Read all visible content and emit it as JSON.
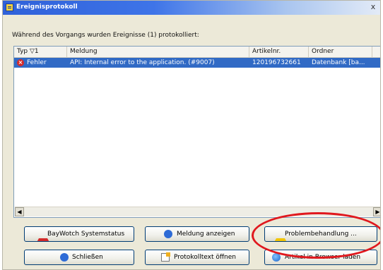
{
  "window": {
    "title": "Ereignisprotokoll",
    "close_glyph": "x"
  },
  "info_text": "Während des Vorgangs wurden Ereignisse (1) protokolliert:",
  "table": {
    "columns": [
      "Typ ▽1",
      "Meldung",
      "Artikelnr.",
      "Ordner"
    ],
    "rows": [
      {
        "type": "Fehler",
        "type_icon": "error-icon",
        "message": "API: Internal error to the application. (#9007)",
        "article": "120196732661",
        "folder": "Datenbank [ba..."
      }
    ]
  },
  "buttons": {
    "baywotch": "BayWotch Systemstatus",
    "show_message": "Meldung anzeigen",
    "troubleshoot": "Problembehandlung ...",
    "close": "Schließen",
    "open_log": "Protokolltext öffnen",
    "load_browser": "Artikel in Browser laden"
  },
  "annotation": {
    "highlight_color": "#e0181e"
  },
  "colors": {
    "selection": "#316ac5",
    "title_bar": "#2f61d9"
  }
}
